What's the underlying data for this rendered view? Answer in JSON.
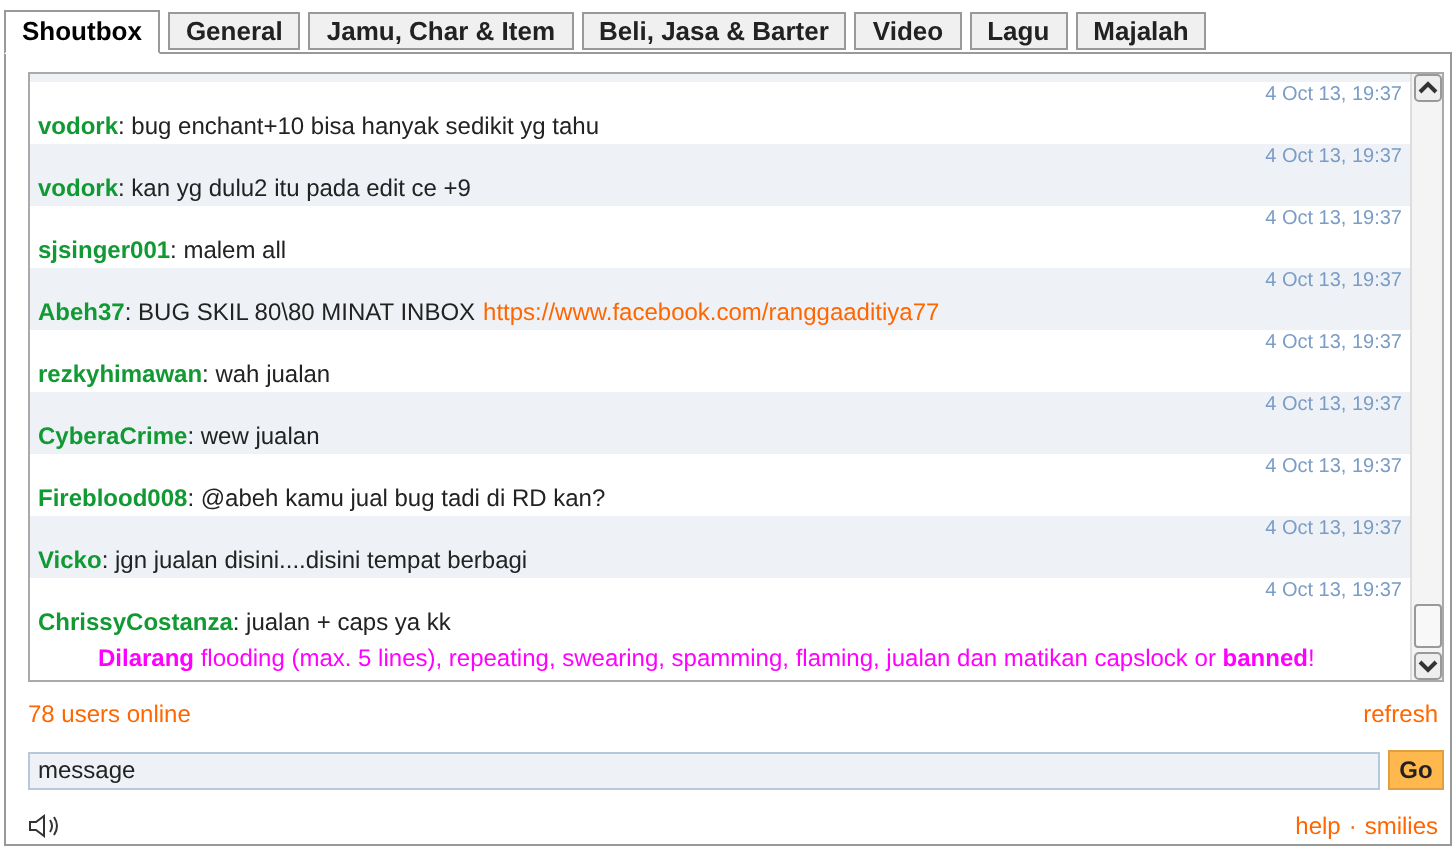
{
  "tabs": [
    {
      "label": "Shoutbox",
      "selected": true
    },
    {
      "label": "General",
      "selected": false
    },
    {
      "label": "Jamu, Char & Item",
      "selected": false
    },
    {
      "label": "Beli, Jasa & Barter",
      "selected": false
    },
    {
      "label": "Video",
      "selected": false
    },
    {
      "label": "Lagu",
      "selected": false
    },
    {
      "label": "Majalah",
      "selected": false
    }
  ],
  "messages": [
    {
      "time": "4 Oct 13, 19:37",
      "user": "vodork",
      "text": ": bug enchant+10 bisa hanyak sedikit yg tahu"
    },
    {
      "time": "4 Oct 13, 19:37",
      "user": "vodork",
      "text": ": kan yg dulu2 itu pada edit ce +9"
    },
    {
      "time": "4 Oct 13, 19:37",
      "user": "sjsinger001",
      "text": ": malem all"
    },
    {
      "time": "4 Oct 13, 19:37",
      "user": "Abeh37",
      "text": ": BUG SKIL 80\\80 MINAT INBOX",
      "link": "https://www.facebook.com/ranggaaditiya77"
    },
    {
      "time": "4 Oct 13, 19:37",
      "user": "rezkyhimawan",
      "text": ": wah jualan"
    },
    {
      "time": "4 Oct 13, 19:37",
      "user": "CyberaCrime",
      "text": ": wew jualan"
    },
    {
      "time": "4 Oct 13, 19:37",
      "user": "Fireblood008",
      "text": ": @abeh kamu jual bug tadi di RD kan?"
    },
    {
      "time": "4 Oct 13, 19:37",
      "user": "Vicko",
      "text": ": jgn jualan disini....disini tempat berbagi"
    },
    {
      "time": "4 Oct 13, 19:37",
      "user": "ChrissyCostanza",
      "text": ": jualan + caps ya kk"
    }
  ],
  "notice": "**Dilarang** flooding (max. 5 lines), repeating, swearing, spamming, flaming, jualan dan matikan capslock or **banned**!",
  "users_online": "78 users online",
  "refresh": "refresh",
  "message_field": {
    "placeholder": "message"
  },
  "go_button": "Go",
  "help": "help",
  "separator": "·",
  "smilies": "smilies"
}
